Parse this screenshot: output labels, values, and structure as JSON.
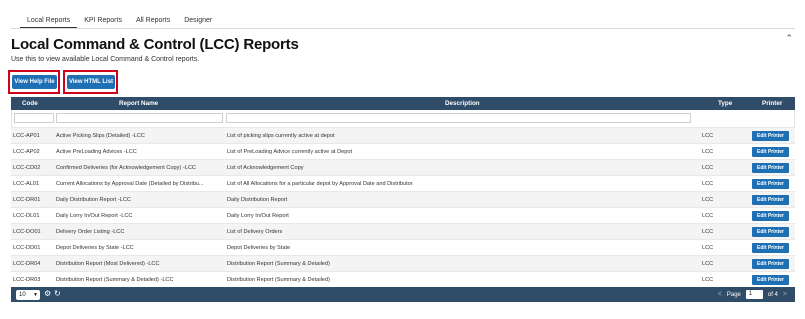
{
  "tabs": [
    "Local Reports",
    "KPI Reports",
    "All Reports",
    "Designer"
  ],
  "page": {
    "title": "Local Command & Control (LCC) Reports",
    "subtitle": "Use this to view available Local Command & Control reports.",
    "collapse_icon": "chevron-up-icon"
  },
  "buttons": {
    "help": "View Help File",
    "html": "View HTML List"
  },
  "colors": {
    "accent": "#1f6fb4",
    "header": "#2f4c68",
    "highlight": "#d0021b"
  },
  "table": {
    "columns": [
      "Code",
      "Report Name",
      "Description",
      "Type",
      "Printer"
    ],
    "rows": [
      {
        "code": "LCC-AP01",
        "name": "Active Picking Slips (Detailed) -LCC",
        "desc": "List of picking slips currently active at depot",
        "type": "LCC",
        "printer": "Edit Printer"
      },
      {
        "code": "LCC-AP02",
        "name": "Active PreLoading Advices -LCC",
        "desc": "List of PreLoading Advice currently active at Depot",
        "type": "LCC",
        "printer": "Edit Printer"
      },
      {
        "code": "LCC-CD02",
        "name": "Confirmed Deliveries (for Acknowledgement Copy) -LCC",
        "desc": "List of Acknowledgement Copy",
        "type": "LCC",
        "printer": "Edit Printer"
      },
      {
        "code": "LCC-AL01",
        "name": "Current Allocations by Approval Date (Detailed by Distribu...",
        "desc": "List of All Allocations for a particular depot by Approval Date and Distributor",
        "type": "LCC",
        "printer": "Edit Printer"
      },
      {
        "code": "LCC-DR01",
        "name": "Daily Distribution Report -LCC",
        "desc": "Daily Distribution Report",
        "type": "LCC",
        "printer": "Edit Printer"
      },
      {
        "code": "LCC-DL01",
        "name": "Daily Lorry In/Out Report -LCC",
        "desc": "Daily Lorry In/Out Report",
        "type": "LCC",
        "printer": "Edit Printer"
      },
      {
        "code": "LCC-DO01",
        "name": "Delivery Order Listing -LCC",
        "desc": "List of Delivery Orders",
        "type": "LCC",
        "printer": "Edit Printer"
      },
      {
        "code": "LCC-DD01",
        "name": "Depot Deliveries by State -LCC",
        "desc": "Depot Deliveries by State",
        "type": "LCC",
        "printer": "Edit Printer"
      },
      {
        "code": "LCC-DR04",
        "name": "Distribution Report (Most Delivered) -LCC",
        "desc": "Distribution Report (Summary & Detailed)",
        "type": "LCC",
        "printer": "Edit Printer"
      },
      {
        "code": "LCC-DR03",
        "name": "Distribution Report (Summary & Detailed) -LCC",
        "desc": "Distribution Report (Summary & Detailed)",
        "type": "LCC",
        "printer": "Edit Printer"
      }
    ]
  },
  "footer": {
    "page_size": "10",
    "page_label": "Page",
    "page_number": "1",
    "page_of": "of 4",
    "prev": "<",
    "next": ">",
    "settings_icon": "gear-icon",
    "refresh_icon": "refresh-icon"
  }
}
